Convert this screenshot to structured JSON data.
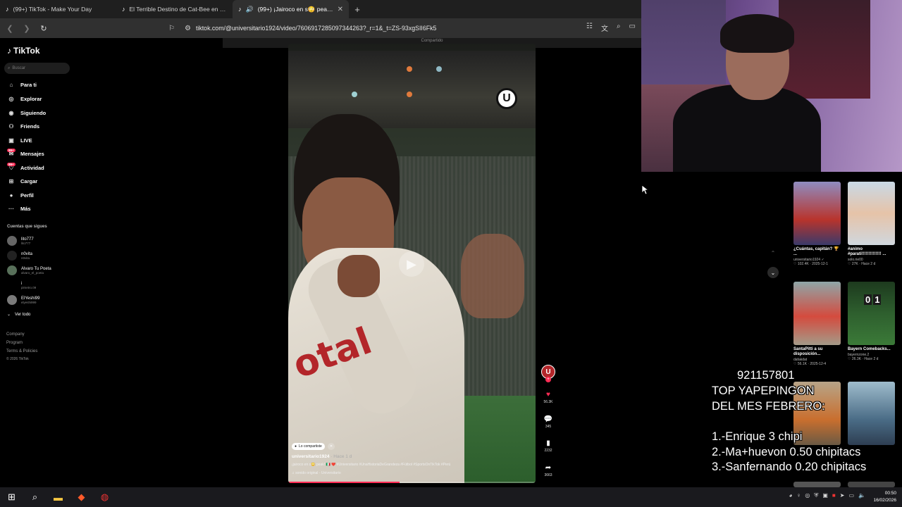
{
  "browser": {
    "tabs": [
      {
        "label": "(99+) TikTok - Make Your Day",
        "active": false
      },
      {
        "label": "El Terrible Destino de Cat-Bee en Pog",
        "active": false
      },
      {
        "label": "(99+) ¡Jairoco en s😳 peak! 😎",
        "active": true
      }
    ],
    "new_tab": "+",
    "url": "tiktok.com/@universitario1924/video/7606917285097344263?_r=1&_t=ZS-93xgSII6Fk5",
    "shared_banner": "Compartido"
  },
  "sidebar": {
    "logo": "TikTok",
    "search_placeholder": "Buscar",
    "menu": [
      {
        "label": "Para ti",
        "icon": "home-icon"
      },
      {
        "label": "Explorar",
        "icon": "compass-icon"
      },
      {
        "label": "Siguiendo",
        "icon": "following-icon"
      },
      {
        "label": "Friends",
        "icon": "friends-icon"
      },
      {
        "label": "LIVE",
        "icon": "live-icon"
      },
      {
        "label": "Mensajes",
        "icon": "messages-icon",
        "badge": "99+"
      },
      {
        "label": "Actividad",
        "icon": "activity-icon",
        "badge": "99+"
      },
      {
        "label": "Cargar",
        "icon": "upload-icon"
      },
      {
        "label": "Perfil",
        "icon": "profile-icon"
      },
      {
        "label": "Más",
        "icon": "more-icon"
      }
    ],
    "following_title": "Cuentas que sigues",
    "following": [
      {
        "name": "lito777",
        "handle": "lito777"
      },
      {
        "name": "n0vita",
        "handle": "n0vita"
      },
      {
        "name": "Alvaro Tu Poeta",
        "handle": "alvaro_el_poeta"
      },
      {
        "name": "i",
        "handle": "pimetro.09"
      },
      {
        "name": "ElYeshi99",
        "handle": "elyeshi999"
      }
    ],
    "see_all": "Ver todo",
    "footer": [
      "Company",
      "Program",
      "Terms & Policies",
      "© 2026 TikTok"
    ]
  },
  "video": {
    "shared_pill": "Lo compartiste",
    "username": "universitario1924",
    "time": "· Hace 1 d",
    "caption": "¡jairoco en s😳 peak! 🇮🇹 ❤️ #Universitario #UnaHistoriaDeGrandeza #Fútbol #SportsOnTikTok #Perú",
    "sound": "sonido original - Universitario",
    "sponsor_text": "otal",
    "club_logo": "U",
    "progress": 0.45
  },
  "actions": [
    {
      "name": "like",
      "icon": "heart-icon",
      "count": "56.3K"
    },
    {
      "name": "comment",
      "icon": "comment-icon",
      "count": "345"
    },
    {
      "name": "save",
      "icon": "bookmark-icon",
      "count": "2232"
    },
    {
      "name": "share",
      "icon": "share-icon",
      "count": "3663"
    }
  ],
  "recommendations": [
    {
      "title": "¿Cuántas, capitán? 🏆 ...",
      "author": "universitario1924 ✓",
      "stats": "♡ 102.4K · 2025-12-1"
    },
    {
      "title": "#animo #parati!!!!!!!!!!!!!! ...",
      "author": "solo.rie00",
      "stats": "♡ 27K · Hace 2 d"
    },
    {
      "title": "SantaPitti a su disposición...",
      "author": "dafakdat",
      "stats": "♡ 56.1K · 2025-12-4"
    },
    {
      "title": "Bayern Comebacks...",
      "author": "bayernzone.2",
      "stats": "♡ 26.3K · Hace 2 d"
    }
  ],
  "score_thumb": {
    "home": "0",
    "away": "1"
  },
  "overlay": {
    "phone": "921157801",
    "title_1": "TOP YAPEPINGON",
    "title_2": "DEL MES FEBRERO:",
    "rank_1": "1.-Enrique 3 chipi",
    "rank_2": "2.-Ma+huevon 0.50 chipitacs",
    "rank_3": "3.-Sanfernando 0.20 chipitacs"
  },
  "taskbar": {
    "time": "00:50",
    "date": "16/02/2026"
  }
}
